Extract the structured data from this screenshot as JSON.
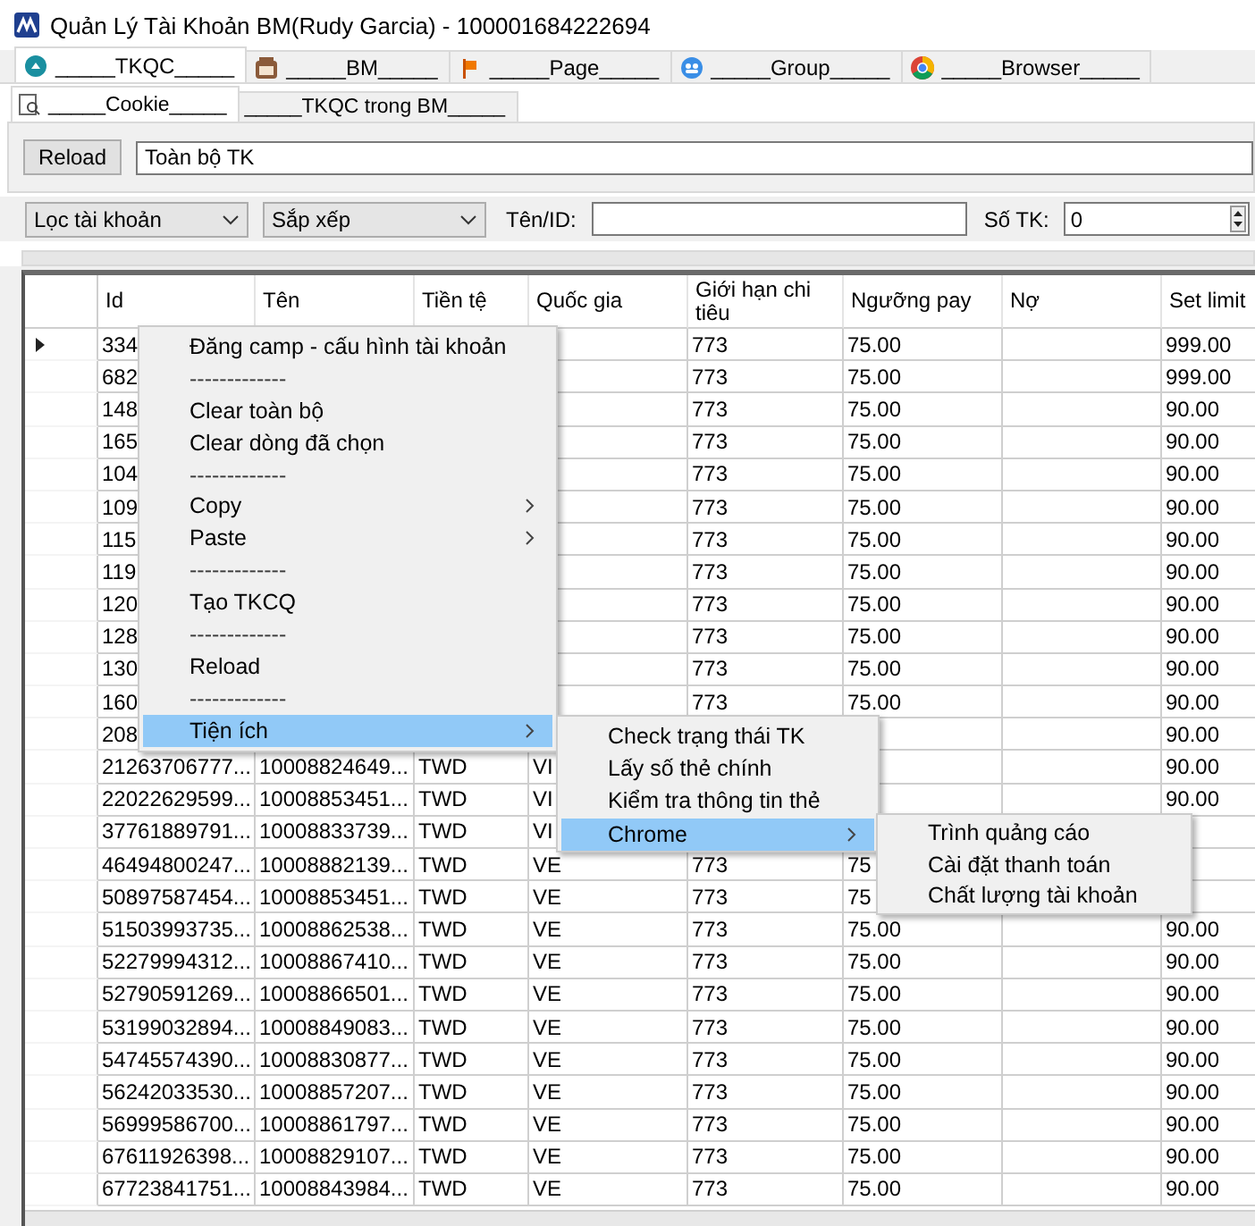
{
  "window": {
    "title": "Quản Lý Tài Khoản BM(Rudy Garcia) - 100001684222694"
  },
  "tabs": [
    {
      "label": "_____TKQC_____",
      "selected": true
    },
    {
      "label": "_____BM_____",
      "selected": false
    },
    {
      "label": "_____Page_____",
      "selected": false
    },
    {
      "label": "_____Group_____",
      "selected": false
    },
    {
      "label": "_____Browser_____",
      "selected": false
    }
  ],
  "subtabs": [
    {
      "label": "_____Cookie_____",
      "selected": true
    },
    {
      "label": "_____TKQC trong BM_____",
      "selected": false
    }
  ],
  "reload_button": "Reload",
  "scope_field": {
    "value": "Toàn bộ TK"
  },
  "filters": {
    "filter_dropdown": {
      "value": "Lọc tài khoản"
    },
    "sort_dropdown": {
      "value": "Sắp xếp"
    },
    "name_id_label": "Tên/ID:",
    "count_label": "Số TK:",
    "count_field": {
      "value": "0"
    }
  },
  "grid": {
    "columns": [
      "Id",
      "Tên",
      "Tiền tệ",
      "Quốc gia",
      "Giới hạn chi tiêu",
      "Ngưỡng pay",
      "Nợ",
      "Set limit"
    ],
    "rows": [
      {
        "current": true,
        "cells": [
          "334",
          null,
          null,
          null,
          "773",
          "75.00",
          null,
          "999.00"
        ]
      },
      {
        "current": false,
        "cells": [
          "682",
          null,
          null,
          null,
          "773",
          "75.00",
          null,
          "999.00"
        ]
      },
      {
        "current": false,
        "cells": [
          "148",
          null,
          null,
          null,
          "773",
          "75.00",
          null,
          "90.00"
        ]
      },
      {
        "current": false,
        "cells": [
          "165",
          null,
          null,
          null,
          "773",
          "75.00",
          null,
          "90.00"
        ]
      },
      {
        "current": false,
        "cells": [
          "104",
          null,
          null,
          null,
          "773",
          "75.00",
          null,
          "90.00"
        ]
      },
      {
        "current": false,
        "cells": [
          "109",
          null,
          null,
          null,
          "773",
          "75.00",
          null,
          "90.00"
        ]
      },
      {
        "current": false,
        "cells": [
          "115",
          null,
          null,
          null,
          "773",
          "75.00",
          null,
          "90.00"
        ]
      },
      {
        "current": false,
        "cells": [
          "119",
          null,
          null,
          null,
          "773",
          "75.00",
          null,
          "90.00"
        ]
      },
      {
        "current": false,
        "cells": [
          "120",
          null,
          null,
          null,
          "773",
          "75.00",
          null,
          "90.00"
        ]
      },
      {
        "current": false,
        "cells": [
          "128",
          null,
          null,
          null,
          "773",
          "75.00",
          null,
          "90.00"
        ]
      },
      {
        "current": false,
        "cells": [
          "130",
          null,
          null,
          null,
          "773",
          "75.00",
          null,
          "90.00"
        ]
      },
      {
        "current": false,
        "cells": [
          "160",
          null,
          null,
          null,
          "773",
          "75.00",
          null,
          "90.00"
        ]
      },
      {
        "current": false,
        "cells": [
          "208",
          null,
          null,
          null,
          null,
          null,
          null,
          "90.00"
        ]
      },
      {
        "current": false,
        "cells": [
          "21263706777...",
          "10008824649...",
          "TWD",
          "VI",
          null,
          null,
          null,
          "90.00"
        ]
      },
      {
        "current": false,
        "cells": [
          "22022629599...",
          "10008853451...",
          "TWD",
          "VI",
          null,
          null,
          null,
          "90.00"
        ]
      },
      {
        "current": false,
        "cells": [
          "37761889791...",
          "10008833739...",
          "TWD",
          "VI",
          null,
          null,
          null,
          null
        ]
      },
      {
        "current": false,
        "cells": [
          "46494800247...",
          "10008882139...",
          "TWD",
          "VE",
          "773",
          "75",
          null,
          null
        ]
      },
      {
        "current": false,
        "cells": [
          "50897587454...",
          "10008853451...",
          "TWD",
          "VE",
          "773",
          "75",
          null,
          null
        ]
      },
      {
        "current": false,
        "cells": [
          "51503993735...",
          "10008862538...",
          "TWD",
          "VE",
          "773",
          "75.00",
          null,
          "90.00"
        ]
      },
      {
        "current": false,
        "cells": [
          "52279994312...",
          "10008867410...",
          "TWD",
          "VE",
          "773",
          "75.00",
          null,
          "90.00"
        ]
      },
      {
        "current": false,
        "cells": [
          "52790591269...",
          "10008866501...",
          "TWD",
          "VE",
          "773",
          "75.00",
          null,
          "90.00"
        ]
      },
      {
        "current": false,
        "cells": [
          "53199032894...",
          "10008849083...",
          "TWD",
          "VE",
          "773",
          "75.00",
          null,
          "90.00"
        ]
      },
      {
        "current": false,
        "cells": [
          "54745574390...",
          "10008830877...",
          "TWD",
          "VE",
          "773",
          "75.00",
          null,
          "90.00"
        ]
      },
      {
        "current": false,
        "cells": [
          "56242033530...",
          "10008857207...",
          "TWD",
          "VE",
          "773",
          "75.00",
          null,
          "90.00"
        ]
      },
      {
        "current": false,
        "cells": [
          "56999586700...",
          "10008861797...",
          "TWD",
          "VE",
          "773",
          "75.00",
          null,
          "90.00"
        ]
      },
      {
        "current": false,
        "cells": [
          "67611926398...",
          "10008829107...",
          "TWD",
          "VE",
          "773",
          "75.00",
          null,
          "90.00"
        ]
      },
      {
        "current": false,
        "cells": [
          "67723841751...",
          "10008843984...",
          "TWD",
          "VE",
          "773",
          "75.00",
          null,
          "90.00"
        ]
      }
    ]
  },
  "context_menu": {
    "items": [
      {
        "kind": "item",
        "label": "Đăng camp - cấu hình tài khoản",
        "has_submenu": false,
        "selected": false
      },
      {
        "kind": "separator",
        "label": "-------------",
        "has_submenu": false,
        "selected": false
      },
      {
        "kind": "item",
        "label": "Clear toàn bộ",
        "has_submenu": false,
        "selected": false
      },
      {
        "kind": "item",
        "label": "Clear dòng đã chọn",
        "has_submenu": false,
        "selected": false
      },
      {
        "kind": "separator",
        "label": "-------------",
        "has_submenu": false,
        "selected": false
      },
      {
        "kind": "item",
        "label": "Copy",
        "has_submenu": true,
        "selected": false
      },
      {
        "kind": "item",
        "label": "Paste",
        "has_submenu": true,
        "selected": false
      },
      {
        "kind": "separator",
        "label": "-------------",
        "has_submenu": false,
        "selected": false
      },
      {
        "kind": "item",
        "label": "Tạo TKCQ",
        "has_submenu": false,
        "selected": false
      },
      {
        "kind": "separator",
        "label": "-------------",
        "has_submenu": false,
        "selected": false
      },
      {
        "kind": "item",
        "label": "Reload",
        "has_submenu": false,
        "selected": false
      },
      {
        "kind": "separator",
        "label": "-------------",
        "has_submenu": false,
        "selected": false
      },
      {
        "kind": "item",
        "label": "Tiện ích",
        "has_submenu": true,
        "selected": true
      }
    ]
  },
  "utilities_menu": {
    "items": [
      {
        "kind": "item",
        "label": "Check trạng thái TK",
        "has_submenu": false,
        "selected": false
      },
      {
        "kind": "item",
        "label": "Lấy số thẻ chính",
        "has_submenu": false,
        "selected": false
      },
      {
        "kind": "item",
        "label": "Kiểm tra thông tin thẻ",
        "has_submenu": false,
        "selected": false
      },
      {
        "kind": "item",
        "label": "Chrome",
        "has_submenu": true,
        "selected": true
      }
    ]
  },
  "chrome_menu": {
    "items": [
      {
        "kind": "item",
        "label": "Trình quảng cáo",
        "has_submenu": false,
        "selected": false
      },
      {
        "kind": "item",
        "label": "Cài đặt thanh toán",
        "has_submenu": false,
        "selected": false
      },
      {
        "kind": "item",
        "label": "Chất lượng tài khoản",
        "has_submenu": false,
        "selected": false
      }
    ]
  }
}
